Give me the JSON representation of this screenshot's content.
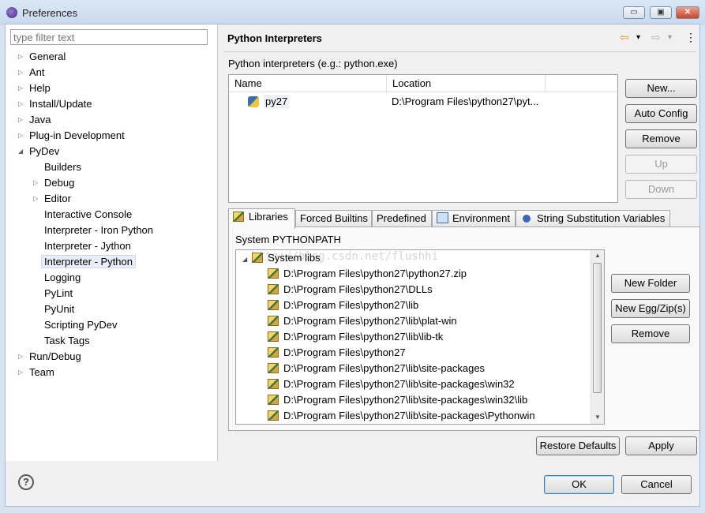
{
  "window": {
    "title": "Preferences",
    "minimize": "▭",
    "maximize": "▣",
    "close": "✕"
  },
  "filter": {
    "placeholder": "type filter text"
  },
  "tree": [
    {
      "label": "General",
      "expander": "▷"
    },
    {
      "label": "Ant",
      "expander": "▷"
    },
    {
      "label": "Help",
      "expander": "▷"
    },
    {
      "label": "Install/Update",
      "expander": "▷"
    },
    {
      "label": "Java",
      "expander": "▷"
    },
    {
      "label": "Plug-in Development",
      "expander": "▷"
    },
    {
      "label": "PyDev",
      "expander": "◢"
    },
    {
      "label": "Builders"
    },
    {
      "label": "Debug",
      "expander": "▷"
    },
    {
      "label": "Editor",
      "expander": "▷"
    },
    {
      "label": "Interactive Console"
    },
    {
      "label": "Interpreter - Iron Python"
    },
    {
      "label": "Interpreter - Jython"
    },
    {
      "label": "Interpreter - Python",
      "selected": true
    },
    {
      "label": "Logging"
    },
    {
      "label": "PyLint"
    },
    {
      "label": "PyUnit"
    },
    {
      "label": "Scripting PyDev"
    },
    {
      "label": "Task Tags"
    },
    {
      "label": "Run/Debug",
      "expander": "▷"
    },
    {
      "label": "Team",
      "expander": "▷"
    }
  ],
  "page": {
    "title": "Python Interpreters",
    "nav": {
      "back": "⇦",
      "forward": "⇨",
      "dropdown": "▾",
      "menu": "▾",
      "more": "⋮"
    },
    "interpreters_label": "Python interpreters (e.g.: python.exe)",
    "columns": [
      "Name",
      "Location"
    ],
    "rows": [
      {
        "name": "py27",
        "location": "D:\\Program Files\\python27\\pyt..."
      }
    ],
    "buttons": {
      "new": "New...",
      "auto_config": "Auto Config",
      "remove": "Remove",
      "up": "Up",
      "down": "Down"
    },
    "tabs": [
      "Libraries",
      "Forced Builtins",
      "Predefined",
      "Environment",
      "String Substitution Variables"
    ],
    "system_pythonpath_label": "System PYTHONPATH",
    "system_libs_label": "System libs",
    "libs": [
      "D:\\Program Files\\python27\\python27.zip",
      "D:\\Program Files\\python27\\DLLs",
      "D:\\Program Files\\python27\\lib",
      "D:\\Program Files\\python27\\lib\\plat-win",
      "D:\\Program Files\\python27\\lib\\lib-tk",
      "D:\\Program Files\\python27",
      "D:\\Program Files\\python27\\lib\\site-packages",
      "D:\\Program Files\\python27\\lib\\site-packages\\win32",
      "D:\\Program Files\\python27\\lib\\site-packages\\win32\\lib",
      "D:\\Program Files\\python27\\lib\\site-packages\\Pythonwin"
    ],
    "lib_buttons": {
      "new_folder": "New Folder",
      "new_egg": "New Egg/Zip(s)",
      "remove": "Remove"
    },
    "restore_defaults": "Restore Defaults",
    "apply": "Apply"
  },
  "footer": {
    "help": "?",
    "ok": "OK",
    "cancel": "Cancel"
  },
  "watermark": "http://blog.csdn.net/flushhi",
  "colors": {
    "window_frame": "#d7e3f1",
    "selection": "#e8eef7"
  }
}
